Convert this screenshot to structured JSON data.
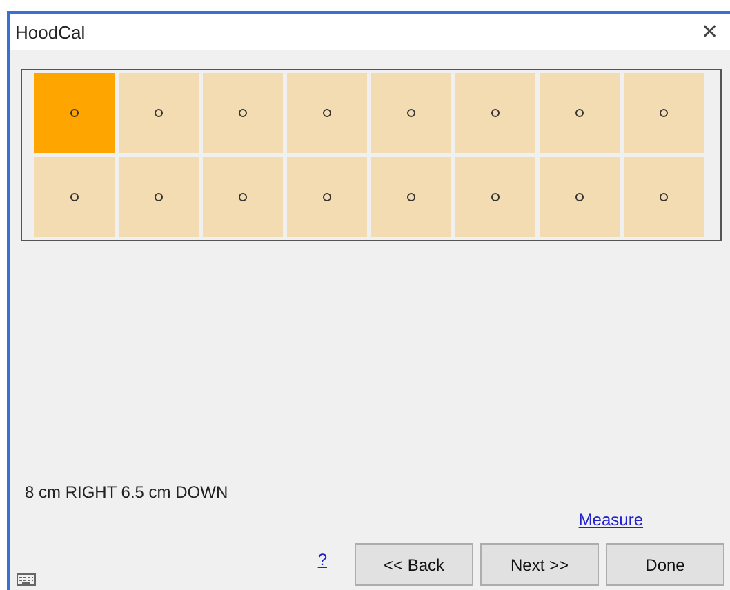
{
  "window": {
    "title": "HoodCal",
    "close": "✕"
  },
  "grid": {
    "rows": [
      {
        "cells": [
          {
            "selected": true
          },
          {
            "selected": false
          },
          {
            "selected": false
          },
          {
            "selected": false
          },
          {
            "selected": false
          },
          {
            "selected": false
          },
          {
            "selected": false
          },
          {
            "selected": false
          }
        ]
      },
      {
        "cells": [
          {
            "selected": false
          },
          {
            "selected": false
          },
          {
            "selected": false
          },
          {
            "selected": false
          },
          {
            "selected": false
          },
          {
            "selected": false
          },
          {
            "selected": false
          },
          {
            "selected": false
          }
        ]
      }
    ]
  },
  "instruction": "8 cm RIGHT 6.5 cm DOWN",
  "measure_link": "Measure",
  "help_link": "?",
  "buttons": [
    "<< Back",
    "Next >>",
    "Done"
  ]
}
